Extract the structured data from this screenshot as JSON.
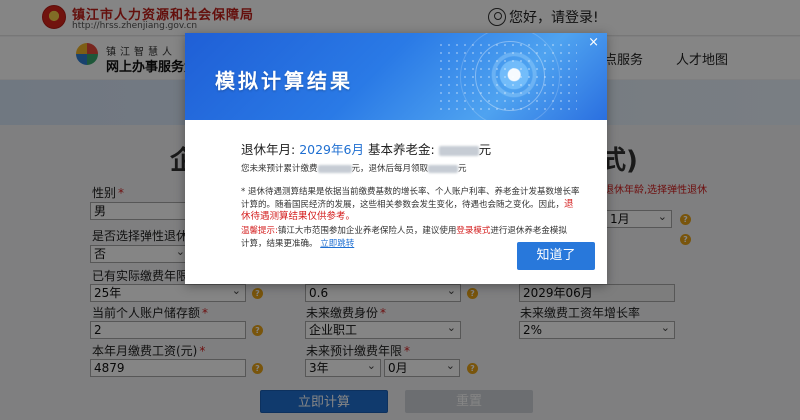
{
  "header": {
    "site_title": "镇江市人力资源和社会保障局",
    "site_url": "http://hrss.zhenjiang.gov.cn",
    "login_text": "您好，请登录!"
  },
  "nav": {
    "subtitle": "镇江智慧人",
    "title": "网上办事服务大",
    "links": [
      "点服务",
      "人才地图"
    ]
  },
  "page": {
    "title_left": "企",
    "title_right": "式)",
    "flex_retire_note": "退休年龄,选择弹性退休"
  },
  "form": {
    "gender": {
      "label": "性别",
      "value": "男"
    },
    "flexible_retire": {
      "label": "是否选择弹性退休",
      "value": "否"
    },
    "paid_years": {
      "label": "已有实际缴费年限",
      "value": "25年"
    },
    "account_balance": {
      "label": "当前个人账户储存额",
      "value": "2"
    },
    "monthly_wage": {
      "label": "本年月缴费工资(元)",
      "value": "4879"
    },
    "mid_value": {
      "value": "0.6"
    },
    "future_identity": {
      "label": "未来缴费身份",
      "value": "企业职工"
    },
    "future_years": {
      "label": "未来预计缴费年限",
      "years": "3年",
      "months": "0月"
    },
    "month_select": {
      "value": "1月"
    },
    "retire_date": {
      "value": "2029年06月"
    },
    "wage_growth": {
      "label": "未来缴费工资年增长率",
      "value": "2%"
    },
    "submit_label": "立即计算",
    "reset_label": "重置"
  },
  "modal": {
    "title": "模拟计算结果",
    "close": "×",
    "retire_label": "退休年月:",
    "retire_value": "2029年6月",
    "pension_label": "基本养老金:",
    "pension_unit": "元",
    "sub_prefix": "您未来预计累计缴费",
    "sub_mid": "元，退休后每月领取",
    "sub_suffix": "元",
    "note_text": "* 退休待遇测算结果是依据当前缴费基数的增长率、个人账户利率、养老金计发基数增长率计算的。随着国民经济的发展，这些相关参数会发生变化，待遇也会随之变化。因此，",
    "note_red": "退休待遇测算结果仅供参考。",
    "tip_label": "温馨提示:",
    "tip_text": "镇江大市范围参加企业养老保险人员，建议使用",
    "tip_link": "登录模式",
    "tip_text2": "进行退休养老金模拟计算，结果更准确。",
    "tip_jump": "立即跳转",
    "ok_label": "知道了"
  },
  "colors": {
    "primary": "#1f6fd1",
    "danger": "#d42020",
    "warning_icon": "#e8a417"
  }
}
